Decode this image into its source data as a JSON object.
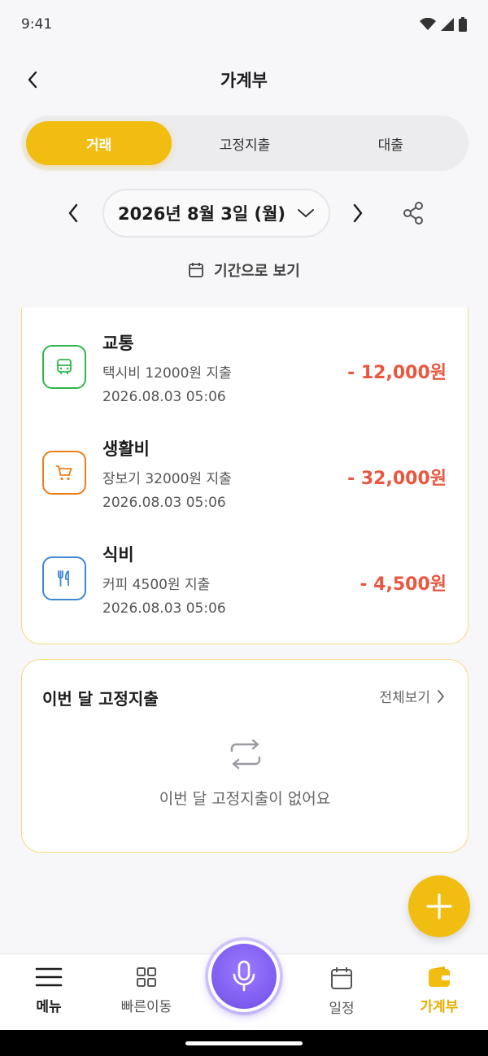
{
  "status": {
    "time": "9:41"
  },
  "header": {
    "title": "가계부"
  },
  "tabs": [
    {
      "label": "거래",
      "active": true
    },
    {
      "label": "고정지출",
      "active": false
    },
    {
      "label": "대출",
      "active": false
    }
  ],
  "date_selector": {
    "date": "2026년 8월 3일 (월)"
  },
  "period_view": {
    "label": "기간으로 보기"
  },
  "transactions": [
    {
      "category": "교통",
      "description": "택시비 12000원 지출",
      "datetime": "2026.08.03 05:06",
      "amount": "- 12,000원",
      "icon": "bus-icon",
      "color": "#2db84d"
    },
    {
      "category": "생활비",
      "description": "장보기 32000원 지출",
      "datetime": "2026.08.03 05:06",
      "amount": "- 32,000원",
      "icon": "cart-icon",
      "color": "#ef7d1a"
    },
    {
      "category": "식비",
      "description": "커피 4500원 지출",
      "datetime": "2026.08.03 05:06",
      "amount": "- 4,500원",
      "icon": "utensils-icon",
      "color": "#3f86d8"
    }
  ],
  "fixed_expense": {
    "title": "이번 달 고정지출",
    "view_all": "전체보기",
    "empty_text": "이번 달 고정지출이 없어요"
  },
  "bottom_nav": [
    {
      "label": "메뉴",
      "icon": "hamburger-icon"
    },
    {
      "label": "빠른이동",
      "icon": "grid-icon"
    },
    {
      "label": "일정",
      "icon": "calendar-icon"
    },
    {
      "label": "가계부",
      "icon": "wallet-icon",
      "active": true
    }
  ],
  "colors": {
    "accent": "#f1bd11",
    "expense": "#e9573f",
    "mic": "#7b5cf0"
  }
}
